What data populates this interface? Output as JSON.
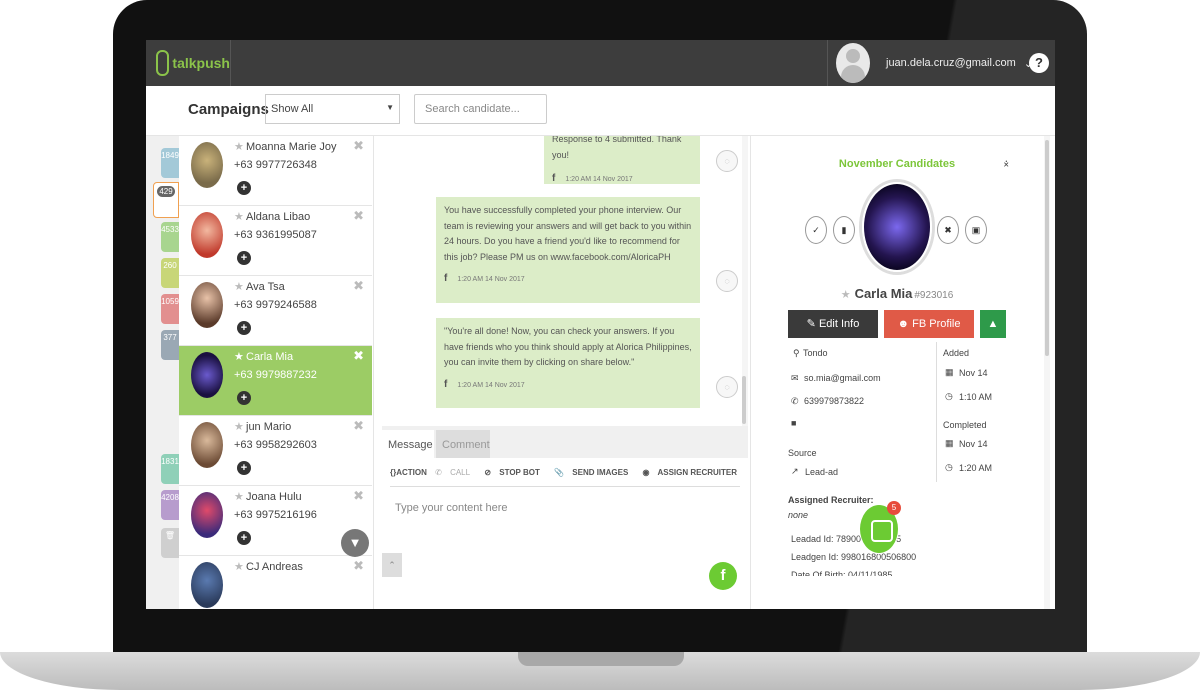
{
  "brand": {
    "name": "talkpush",
    "accent": "#8bc34a"
  },
  "header": {
    "user_email": "juan.dela.cruz@gmail.com",
    "help_label": "?"
  },
  "toolbar": {
    "title": "Campaigns",
    "filter_value": "Show All",
    "search_placeholder": "Search candidate..."
  },
  "rail_counts": [
    "1849",
    "429",
    "4533",
    "260",
    "1059",
    "377",
    "1831",
    "4208"
  ],
  "candidates": [
    {
      "name": "Moanna Marie Joy",
      "phone": "+63 9977726348",
      "active": false
    },
    {
      "name": "Aldana Libao",
      "phone": "+63 9361995087",
      "active": false
    },
    {
      "name": "Ava Tsa",
      "phone": "+63 9979246588",
      "active": false
    },
    {
      "name": "Carla Mia",
      "phone": "+63 9979887232",
      "active": true
    },
    {
      "name": "jun Mario",
      "phone": "+63 9958292603",
      "active": false
    },
    {
      "name": "Joana Hulu",
      "phone": "+63 9975216196",
      "active": false
    },
    {
      "name": "CJ Andreas",
      "phone": "",
      "active": false
    }
  ],
  "messages": [
    {
      "text": "Response to 4 submitted. Thank you!",
      "time": "1:20 AM 14 Nov 2017"
    },
    {
      "text": "You have successfully completed your phone interview. Our team is reviewing your answers and will get back to you within 24 hours. Do you have a friend you'd like to recommend for this job? Please PM us on www.facebook.com/AloricaPH",
      "time": "1:20 AM 14 Nov 2017"
    },
    {
      "text": "\"You're all done! Now, you can check your answers. If you have friends who you think should apply at Alorica Philippines, you can invite them by clicking on share below.\"",
      "time": "1:20 AM 14 Nov 2017"
    }
  ],
  "compose": {
    "tabs": [
      "Message",
      "Comment"
    ],
    "actions": [
      "{}ACTION",
      "CALL",
      "STOP BOT",
      "SEND IMAGES",
      "ASSIGN RECRUITER"
    ],
    "placeholder": "Type your content here",
    "send_icon": "f"
  },
  "profile": {
    "campaign": "November Candidates",
    "name": "Carla Mia",
    "id": "#923016",
    "edit_label": "Edit Info",
    "fb_label": "FB Profile",
    "location": "Tondo",
    "email": "so.mia@gmail.com",
    "phone": "639979873822",
    "added_label": "Added",
    "added_date": "Nov 14",
    "added_time": "1:10 AM",
    "completed_label": "Completed",
    "completed_date": "Nov 14",
    "completed_time": "1:20 AM",
    "source_label": "Source",
    "source_value": "Lead-ad",
    "recruiter_label": "Assigned Recruiter:",
    "recruiter_value": "none",
    "leadad_id": "Leadad Id: 7890072920745",
    "leadgen_id": "Leadgen Id: 998016800506800",
    "dob": "Date Of Birth: 04/11/1985"
  },
  "chat_widget": {
    "badge": "5"
  }
}
